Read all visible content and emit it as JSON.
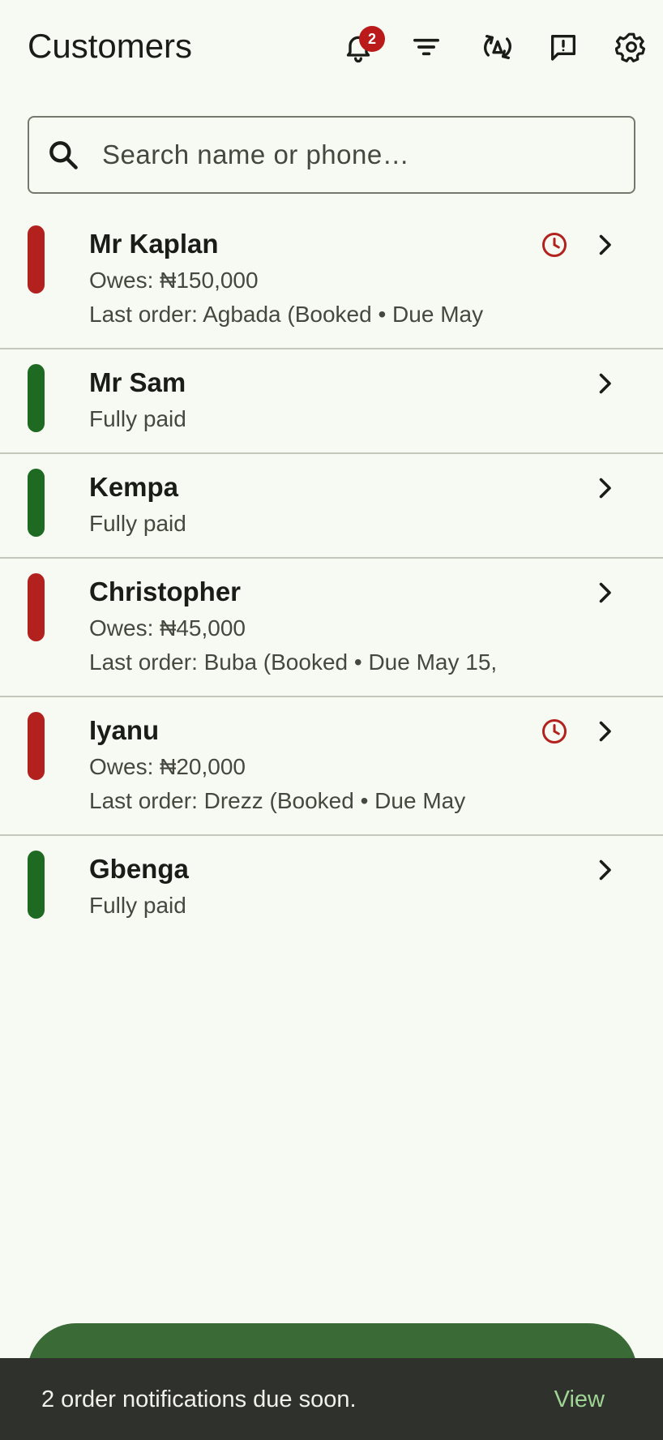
{
  "header": {
    "title": "Customers",
    "notification_count": "2",
    "icons": [
      "bell-icon",
      "filter-icon",
      "sync-icon",
      "feedback-icon",
      "gear-icon"
    ]
  },
  "search": {
    "placeholder": "Search name or phone…",
    "value": ""
  },
  "customers": [
    {
      "name": "Mr Kaplan",
      "status": "owes",
      "line1": "Owes: ₦150,000",
      "line2": "Last order: Agbada (Booked • Due May",
      "due_soon": true
    },
    {
      "name": "Mr Sam",
      "status": "paid",
      "line1": "Fully paid",
      "line2": "",
      "due_soon": false
    },
    {
      "name": "Kempa",
      "status": "paid",
      "line1": "Fully paid",
      "line2": "",
      "due_soon": false
    },
    {
      "name": "Christopher",
      "status": "owes",
      "line1": "Owes: ₦45,000",
      "line2": "Last order: Buba (Booked • Due May 15,",
      "due_soon": false
    },
    {
      "name": "Iyanu",
      "status": "owes",
      "line1": "Owes: ₦20,000",
      "line2": "Last order: Drezz (Booked • Due May",
      "due_soon": true
    },
    {
      "name": "Gbenga",
      "status": "paid",
      "line1": "Fully paid",
      "line2": "",
      "due_soon": false
    }
  ],
  "snackbar": {
    "message": "2 order notifications due soon.",
    "action": "View"
  },
  "colors": {
    "owes": "#b3211f",
    "paid": "#1e6a22",
    "fab": "#3a6a35",
    "snackbar_bg": "#2f312d",
    "snackbar_action": "#9fd494"
  }
}
